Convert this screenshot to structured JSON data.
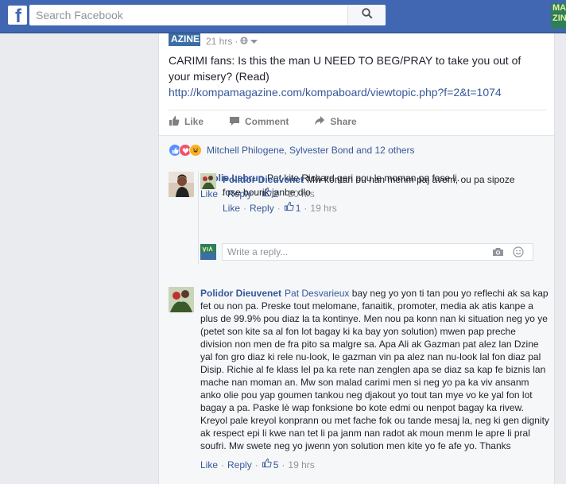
{
  "topbar": {
    "logo": "f",
    "search_placeholder": "Search Facebook",
    "corner_thumb_text": "MA ZINE"
  },
  "post": {
    "page_thumb_text": "AZINE",
    "time": "21 hrs",
    "text": "CARIMI fans: Is this the man U NEED TO BEG/PRAY to take you out of your misery? (Read)",
    "link": "http://kompamagazine.com/kompaboard/viewtopic.php?f=2&t=1074",
    "actions": {
      "like": "Like",
      "comment": "Comment",
      "share": "Share"
    }
  },
  "reactions": {
    "names": "Mitchell Philogene, Sylvester Bond and 12 others",
    "icons": [
      "like-reaction-icon",
      "love-reaction-icon",
      "haha-reaction-icon"
    ],
    "colors": {
      "like": "#5890ff",
      "love": "#f25268",
      "haha": "#f7b125"
    }
  },
  "comments": [
    {
      "author": "Neolie Lebrun",
      "text": "Pat kite Richard geri pou le moman pa fose li.",
      "like_label": "Like",
      "reply_label": "Reply",
      "likes": "2",
      "time": "20 hrs",
      "replies": [
        {
          "author": "Polidor Dieuvenet",
          "text": "Mw kontan ou nan menm paj avem, ou pa sipoze fose bourik janbe dlo",
          "like_label": "Like",
          "reply_label": "Reply",
          "likes": "1",
          "time": "19 hrs"
        }
      ],
      "reply_placeholder": "Write a reply..."
    },
    {
      "author": "Polidor Dieuvenet",
      "mention": "Pat Desvarieux",
      "text": "bay neg yo yon ti tan pou yo reflechi ak sa kap fet ou non pa. Preske tout melomane, fanaitik, promoter, media ak atis kanpe a plus de 99.9% pou diaz la ta kontinye. Men nou pa konn nan ki situation neg yo ye (petet son kite sa al fon lot bagay ki ka bay yon solution) mwen pap preche division non men de fra pito sa malgre sa. Apa Ali ak Gazman pat alez lan Dzine yal fon gro diaz ki rele nu-look, le gazman vin pa alez nan nu-look lal fon diaz pal Disip. Richie al fe klass lel pa ka rete nan zenglen apa se diaz sa kap fe biznis lan mache nan moman an. Mw son malad carimi men si neg yo pa ka viv ansanm anko olie pou yap goumen tankou neg djakout yo tout tan mye vo ke yal fon lot bagay a pa. Paske lè wap fonksione bo kote edmi ou nenpot bagay ka rivew. Kreyol pale kreyol konprann ou met fache fok ou tande mesaj la, neg ki gen dignity ak respect epi li kwe nan tet li pa janm nan radot ak moun menm le apre li pral soufri. Mw swete neg yo jwenn yon solution men kite yo fe afe yo. Thanks",
      "like_label": "Like",
      "reply_label": "Reply",
      "likes": "5",
      "time": "19 hrs"
    }
  ]
}
